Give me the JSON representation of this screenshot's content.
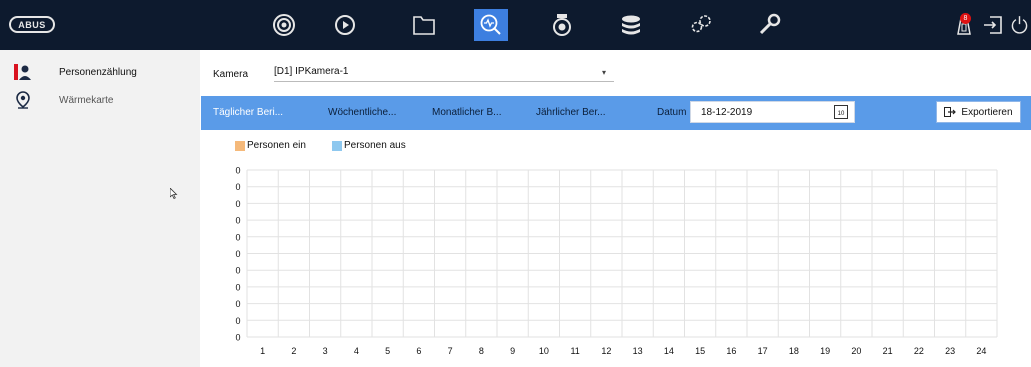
{
  "brand": {
    "logo_text": "ABUS"
  },
  "topbar": {
    "icons": [
      {
        "name": "live-view-icon",
        "active": false
      },
      {
        "name": "playback-icon",
        "active": false
      },
      {
        "name": "file-folder-icon",
        "active": false
      },
      {
        "name": "analysis-icon",
        "active": true
      },
      {
        "name": "camera-icon",
        "active": false
      },
      {
        "name": "storage-icon",
        "active": false
      },
      {
        "name": "settings-icon",
        "active": false
      },
      {
        "name": "maintenance-icon",
        "active": false
      }
    ],
    "notification_count": "8"
  },
  "sidebar": {
    "items": [
      {
        "label": "Personenzählung",
        "icon": "people-counting-icon",
        "active": true
      },
      {
        "label": "Wärmekarte",
        "icon": "heatmap-pin-icon",
        "active": false
      }
    ]
  },
  "camera": {
    "label": "Kamera",
    "value": "[D1] IPKamera-1"
  },
  "tabs": [
    {
      "label": "Täglicher Beri...",
      "active": true
    },
    {
      "label": "Wöchentliche...",
      "active": false
    },
    {
      "label": "Monatlicher B...",
      "active": false
    },
    {
      "label": "Jährlicher Ber...",
      "active": false
    }
  ],
  "date": {
    "label": "Datum",
    "value": "18-12-2019",
    "calendar_day": "10"
  },
  "export": {
    "label": "Exportieren"
  },
  "chart_data": {
    "type": "bar",
    "categories": [
      "1",
      "2",
      "3",
      "4",
      "5",
      "6",
      "7",
      "8",
      "9",
      "10",
      "11",
      "12",
      "13",
      "14",
      "15",
      "16",
      "17",
      "18",
      "19",
      "20",
      "21",
      "22",
      "23",
      "24"
    ],
    "series": [
      {
        "name": "Personen ein",
        "color": "#f5b97a",
        "values": [
          0,
          0,
          0,
          0,
          0,
          0,
          0,
          0,
          0,
          0,
          0,
          0,
          0,
          0,
          0,
          0,
          0,
          0,
          0,
          0,
          0,
          0,
          0,
          0
        ]
      },
      {
        "name": "Personen aus",
        "color": "#8ec8ef",
        "values": [
          0,
          0,
          0,
          0,
          0,
          0,
          0,
          0,
          0,
          0,
          0,
          0,
          0,
          0,
          0,
          0,
          0,
          0,
          0,
          0,
          0,
          0,
          0,
          0
        ]
      }
    ],
    "y_tick_labels": [
      "0",
      "0",
      "0",
      "0",
      "0",
      "0",
      "0",
      "0",
      "0",
      "0",
      "0"
    ],
    "grid": true,
    "legend_position": "top-left"
  }
}
